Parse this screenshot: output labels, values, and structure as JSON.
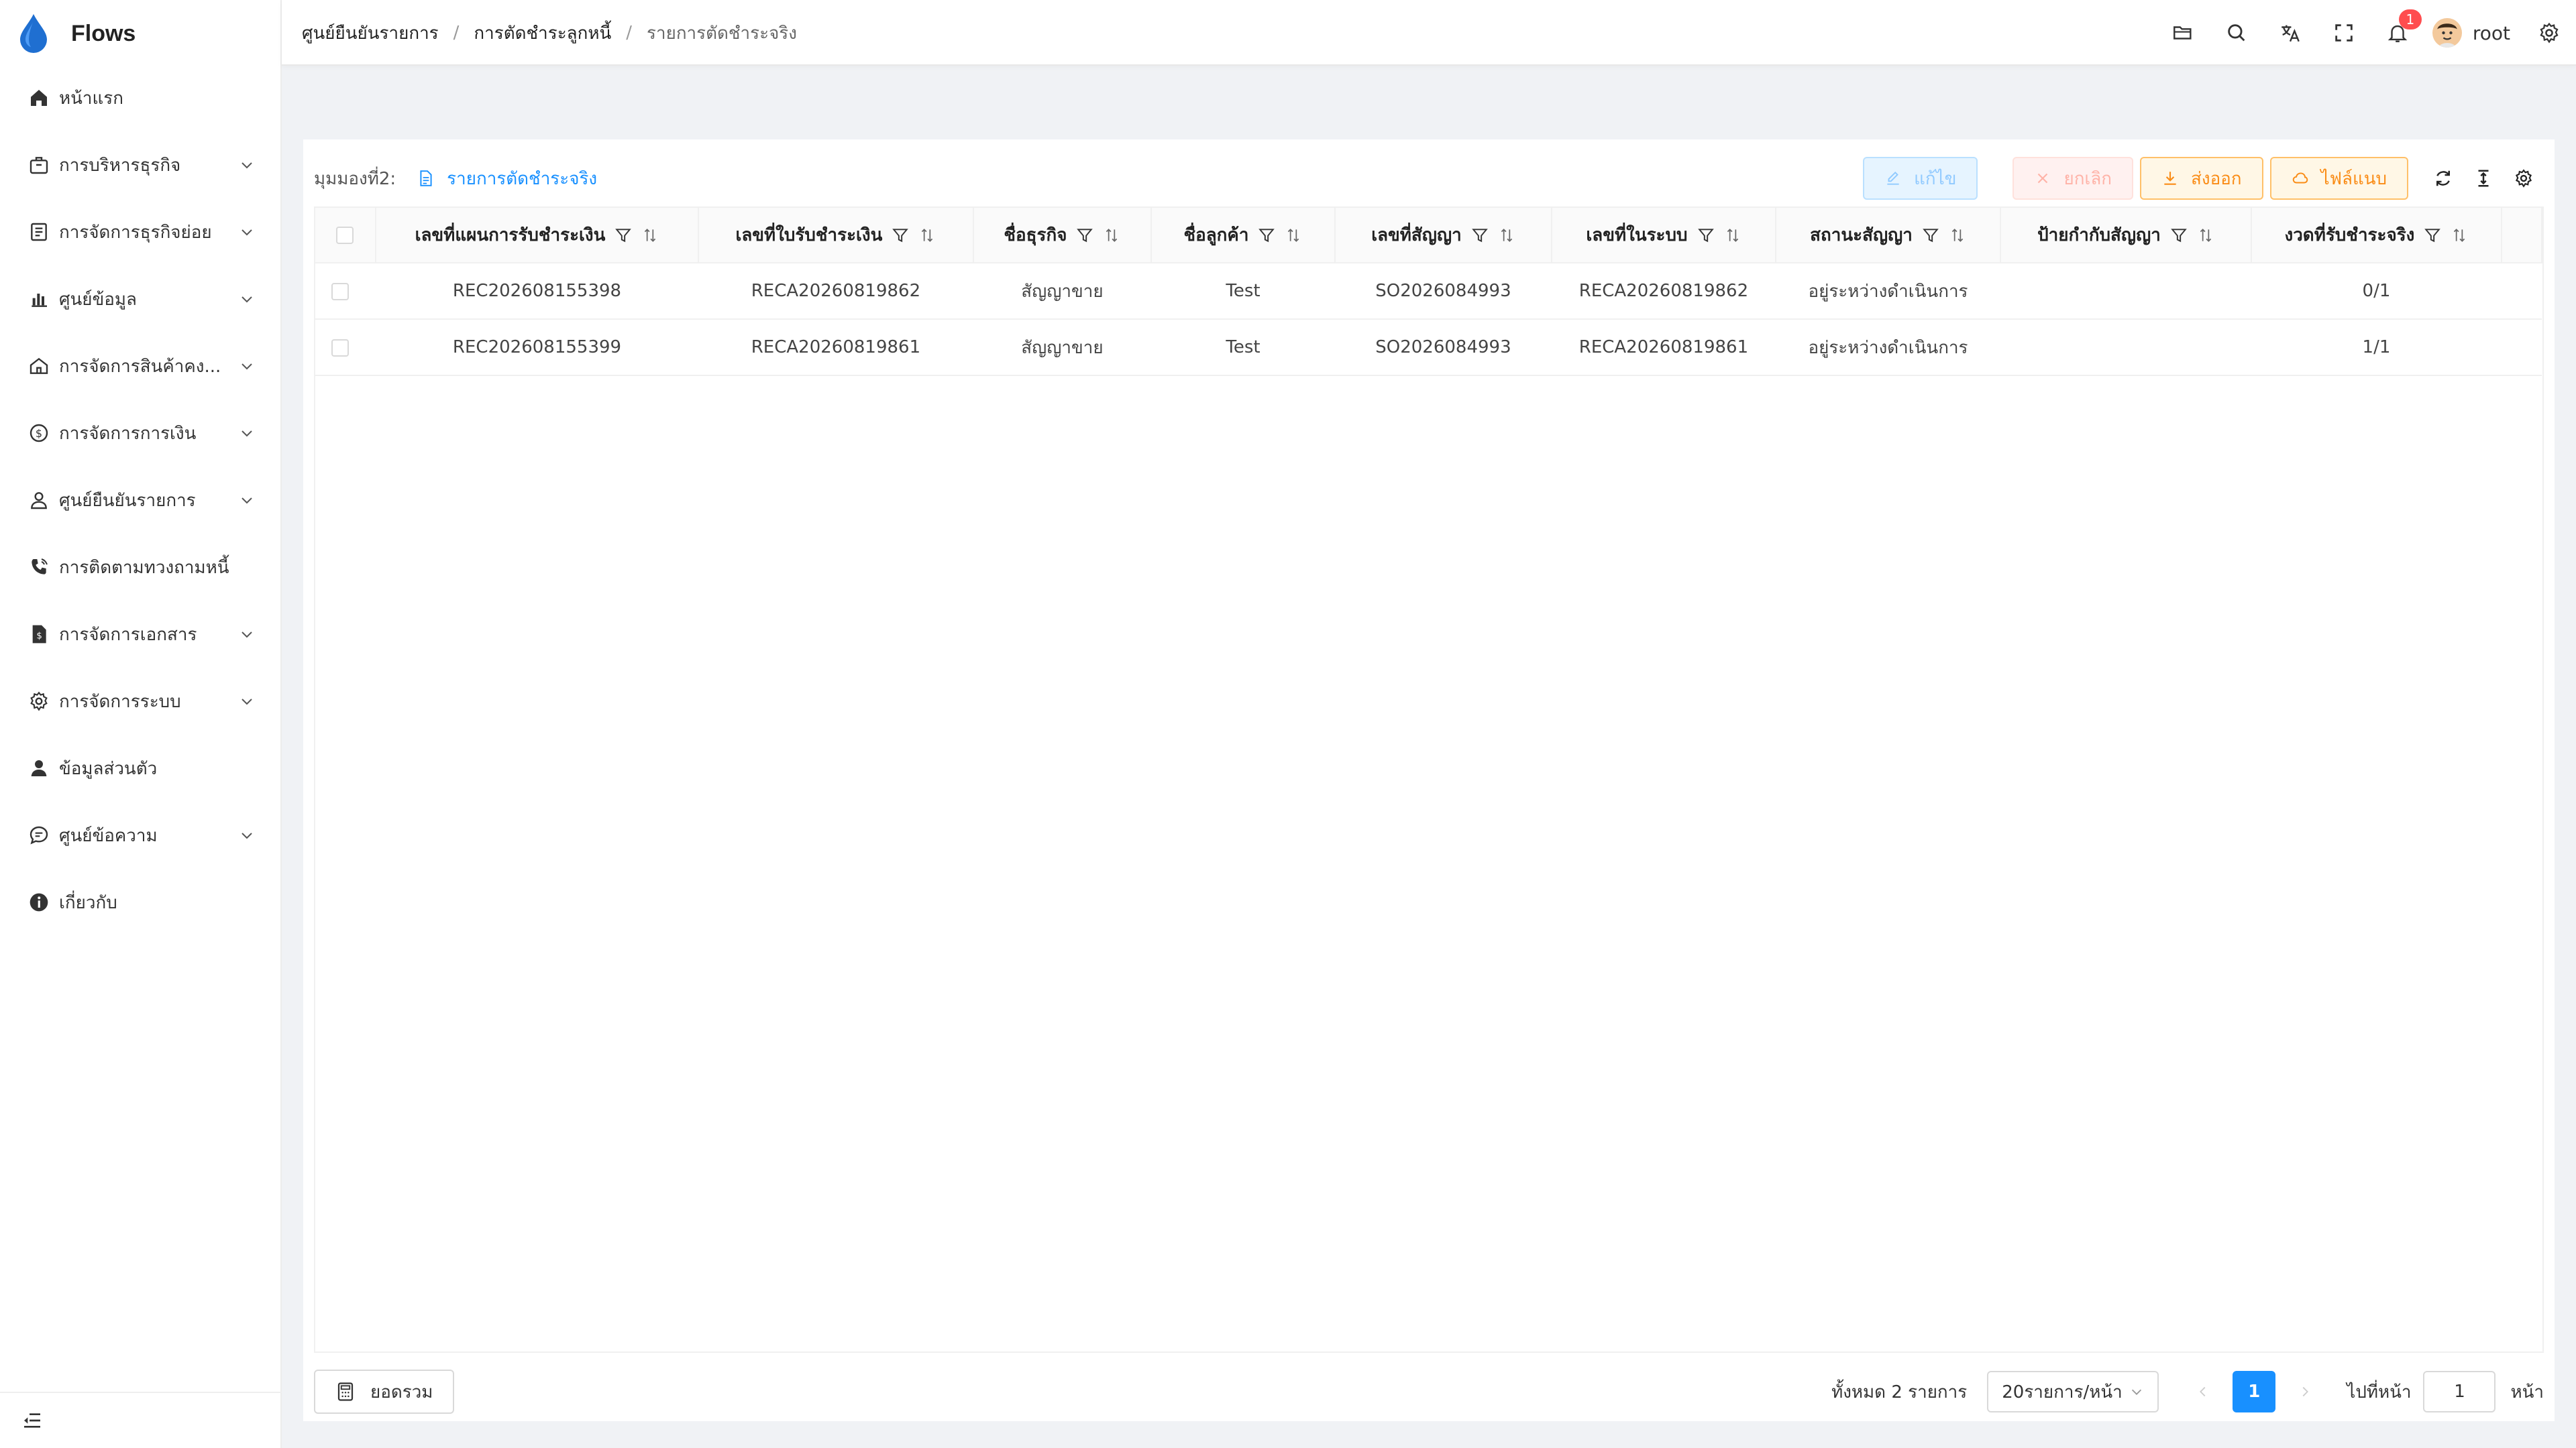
{
  "app": {
    "name": "Flows"
  },
  "sidebar": {
    "items": [
      {
        "label": "หน้าแรก",
        "icon": "home-icon",
        "has_children": false
      },
      {
        "label": "การบริหารธุรกิจ",
        "icon": "briefcase-icon",
        "has_children": true
      },
      {
        "label": "การจัดการธุรกิจย่อย",
        "icon": "list-doc-icon",
        "has_children": true
      },
      {
        "label": "ศูนย์ข้อมูล",
        "icon": "bar-chart-icon",
        "has_children": true
      },
      {
        "label": "การจัดการสินค้าคง...",
        "icon": "house-icon",
        "has_children": true
      },
      {
        "label": "การจัดการการเงิน",
        "icon": "dollar-circle-icon",
        "has_children": true
      },
      {
        "label": "ศูนย์ยืนยันรายการ",
        "icon": "user-icon",
        "has_children": true
      },
      {
        "label": "การติดตามทวงถามหนี้",
        "icon": "phone-icon",
        "has_children": false
      },
      {
        "label": "การจัดการเอกสาร",
        "icon": "file-dollar-icon",
        "has_children": true
      },
      {
        "label": "การจัดการระบบ",
        "icon": "gear-icon",
        "has_children": true
      },
      {
        "label": "ข้อมูลส่วนตัว",
        "icon": "person-icon",
        "has_children": false
      },
      {
        "label": "ศูนย์ข้อความ",
        "icon": "message-icon",
        "has_children": true
      },
      {
        "label": "เกี่ยวกับ",
        "icon": "info-icon",
        "has_children": false
      }
    ]
  },
  "header": {
    "breadcrumb": [
      "ศูนย์ยืนยันรายการ",
      "การตัดชำระลูกหนี้",
      "รายการตัดชำระจริง"
    ],
    "separator": "/",
    "notification_count": "1",
    "username": "root"
  },
  "toolbar": {
    "view_label": "มุมมองที่2:",
    "view_name": "รายการตัดชำระจริง",
    "edit_label": "แก้ไข",
    "cancel_label": "ยกเลิก",
    "export_label": "ส่งออก",
    "attach_label": "ไฟล์แนบ"
  },
  "table": {
    "columns": [
      "เลขที่แผนการรับชำระเงิน",
      "เลขที่ใบรับชำระเงิน",
      "ชื่อธุรกิจ",
      "ชื่อลูกค้า",
      "เลขที่สัญญา",
      "เลขที่ในระบบ",
      "สถานะสัญญา",
      "ป้ายกำกับสัญญา",
      "งวดที่รับชำระจริง"
    ],
    "rows": [
      [
        "REC202608155398",
        "RECA20260819862",
        "สัญญาขาย",
        "Test",
        "SO2026084993",
        "RECA20260819862",
        "อยู่ระหว่างดำเนินการ",
        "",
        "0/1"
      ],
      [
        "REC202608155399",
        "RECA20260819861",
        "สัญญาขาย",
        "Test",
        "SO2026084993",
        "RECA20260819861",
        "อยู่ระหว่างดำเนินการ",
        "",
        "1/1"
      ]
    ]
  },
  "footer": {
    "summary_label": "ยอดรวม",
    "total_text": "ทั้งหมด 2 รายการ",
    "page_size": "20รายการ/หน้า",
    "current_page": "1",
    "goto_label": "ไปที่หน้า",
    "goto_value": "1",
    "goto_suffix": "หน้า"
  },
  "colors": {
    "primary": "#1890ff",
    "warning": "#fa8c16",
    "danger_badge": "#ff4d4f"
  }
}
